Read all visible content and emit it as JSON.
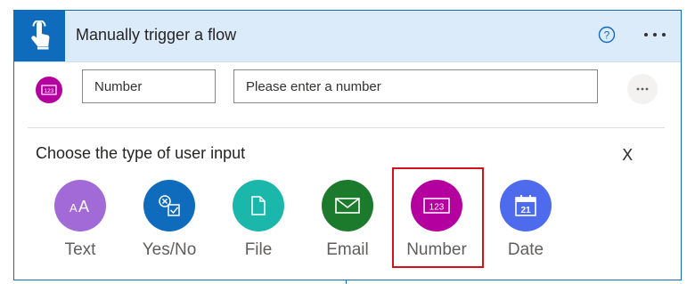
{
  "header": {
    "title": "Manually trigger a flow",
    "help_icon": "help-circle-icon",
    "more_icon": "more-horizontal-icon"
  },
  "input_row": {
    "name_value": "Number",
    "description_value": "Please enter a number",
    "badge_icon": "number-123-icon",
    "more_icon": "more-horizontal-icon"
  },
  "chooser": {
    "title": "Choose the type of user input",
    "close_label": "X",
    "selected": "Number",
    "options": [
      {
        "label": "Text",
        "icon": "text-aa-icon",
        "color": "#a26ad6"
      },
      {
        "label": "Yes/No",
        "icon": "yes-no-icon",
        "color": "#0f6cbd"
      },
      {
        "label": "File",
        "icon": "file-icon",
        "color": "#1ab7aa"
      },
      {
        "label": "Email",
        "icon": "email-icon",
        "color": "#1b7a2c"
      },
      {
        "label": "Number",
        "icon": "number-123-icon",
        "color": "#b4009e"
      },
      {
        "label": "Date",
        "icon": "calendar-icon",
        "color": "#4f6bed"
      }
    ]
  },
  "colors": {
    "accent": "#0f6cbd",
    "header_bg": "#dcebfa",
    "selection_border": "#d1121a"
  }
}
